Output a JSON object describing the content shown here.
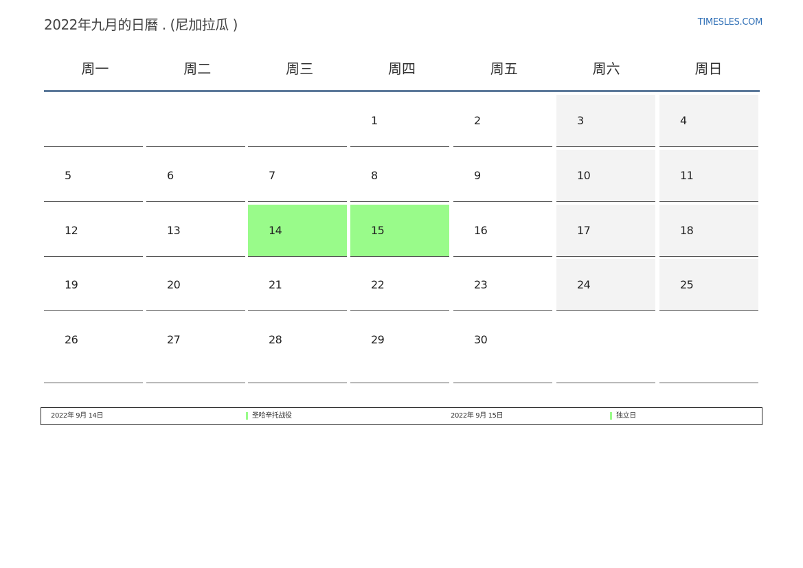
{
  "title": "2022年九月的日曆 . (尼加拉瓜 )",
  "site": "TIMESLES.COM",
  "weekdays": [
    "周一",
    "周二",
    "周三",
    "周四",
    "周五",
    "周六",
    "周日"
  ],
  "weeks": [
    [
      "",
      "",
      "",
      "1",
      "2",
      "3",
      "4"
    ],
    [
      "5",
      "6",
      "7",
      "8",
      "9",
      "10",
      "11"
    ],
    [
      "12",
      "13",
      "14",
      "15",
      "16",
      "17",
      "18"
    ],
    [
      "19",
      "20",
      "21",
      "22",
      "23",
      "24",
      "25"
    ],
    [
      "26",
      "27",
      "28",
      "29",
      "30",
      "",
      ""
    ]
  ],
  "holidays": [
    "14",
    "15"
  ],
  "colors": {
    "holiday": "#99fb8a",
    "weekend": "#f3f3f3",
    "header_rule": "#5d7a9a",
    "site_link": "#2f6fb6"
  },
  "legend": [
    {
      "date": "2022年 9月 14日",
      "name": "圣哈辛托战役"
    },
    {
      "date": "2022年 9月 15日",
      "name": "独立日"
    }
  ]
}
